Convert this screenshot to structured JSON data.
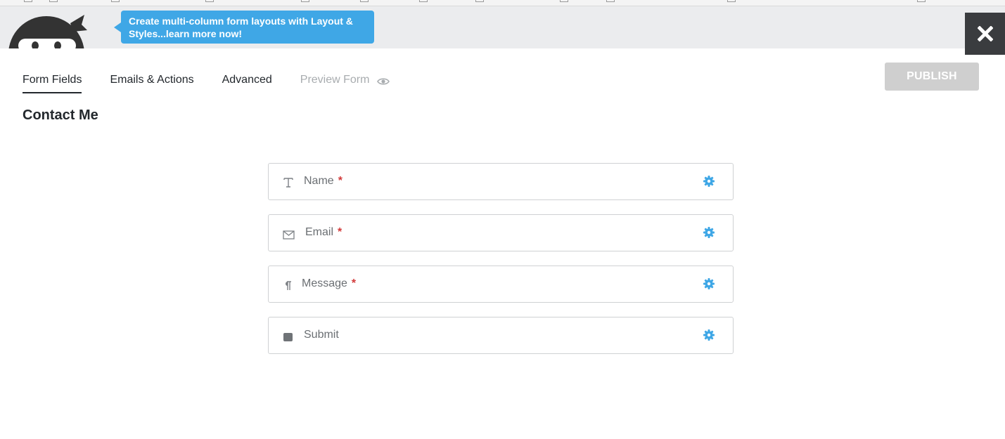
{
  "promo": {
    "text": "Create multi-column form layouts with Layout & Styles...learn more now!"
  },
  "tabs": [
    {
      "label": "Form Fields",
      "active": true
    },
    {
      "label": "Emails & Actions",
      "active": false
    },
    {
      "label": "Advanced",
      "active": false
    },
    {
      "label": "Preview Form",
      "active": false,
      "icon": "eye-icon"
    }
  ],
  "publish": {
    "label": "PUBLISH"
  },
  "form": {
    "title": "Contact Me"
  },
  "fields": [
    {
      "label": "Name",
      "required_mark": "*",
      "icon": "text-field-icon"
    },
    {
      "label": "Email",
      "required_mark": "*",
      "icon": "envelope-icon"
    },
    {
      "label": "Message",
      "required_mark": "*",
      "icon": "paragraph-icon"
    },
    {
      "label": "Submit",
      "required_mark": "",
      "icon": "submit-button-icon"
    }
  ],
  "colors": {
    "accent": "#3fa7e6",
    "gear": "#3fa7e6",
    "required": "#d23a3a",
    "close_bg": "#3a3c3f",
    "publish_disabled": "#cfcfcf"
  }
}
